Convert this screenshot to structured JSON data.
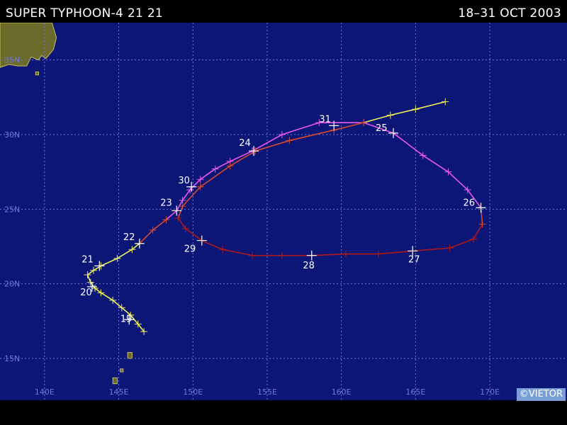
{
  "header": {
    "title": "SUPER TYPHOON-4  21 21",
    "dates": "18–31 OCT 2003"
  },
  "credit": "©VIETOR",
  "map": {
    "lon_range": [
      137,
      175.2
    ],
    "lat_range": [
      12.2,
      37.5
    ],
    "lon_ticks": [
      140,
      145,
      150,
      155,
      160,
      165,
      170
    ],
    "lat_ticks": [
      15,
      20,
      25,
      30,
      35
    ],
    "lon_labels": [
      "140E",
      "145E",
      "150E",
      "155E",
      "160E",
      "165E",
      "170E"
    ],
    "lat_labels": [
      "15N",
      "20N",
      "25N",
      "30N",
      "35N"
    ],
    "colors": {
      "ocean": "#0b1677",
      "grid": "#6f7bd8",
      "land": "#6b6a2a",
      "land_edge": "#c8c060",
      "tropical_storm": "#f0f05a",
      "typhoon": "#d84a2a",
      "super_typhoon": "#ea5aea",
      "dissipating": "#b11818"
    },
    "track": [
      {
        "lon": 146.7,
        "lat": 16.8,
        "cat": "tropical_storm"
      },
      {
        "lon": 146.3,
        "lat": 17.3,
        "cat": "tropical_storm"
      },
      {
        "lon": 145.8,
        "lat": 17.9,
        "cat": "tropical_storm"
      },
      {
        "lon": 145.2,
        "lat": 18.4,
        "cat": "tropical_storm"
      },
      {
        "lon": 144.6,
        "lat": 18.9,
        "cat": "tropical_storm"
      },
      {
        "lon": 143.8,
        "lat": 19.4,
        "cat": "tropical_storm"
      },
      {
        "lon": 143.4,
        "lat": 19.7,
        "cat": "tropical_storm"
      },
      {
        "lon": 143.1,
        "lat": 20.1,
        "cat": "tropical_storm"
      },
      {
        "lon": 142.9,
        "lat": 20.6,
        "cat": "tropical_storm"
      },
      {
        "lon": 143.3,
        "lat": 20.9,
        "cat": "tropical_storm"
      },
      {
        "lon": 143.8,
        "lat": 21.2,
        "cat": "tropical_storm"
      },
      {
        "lon": 144.9,
        "lat": 21.7,
        "cat": "tropical_storm"
      },
      {
        "lon": 145.9,
        "lat": 22.3,
        "cat": "tropical_storm"
      },
      {
        "lon": 146.4,
        "lat": 22.7,
        "cat": "tropical_storm"
      },
      {
        "lon": 147.3,
        "lat": 23.6,
        "cat": "typhoon"
      },
      {
        "lon": 148.2,
        "lat": 24.3,
        "cat": "typhoon"
      },
      {
        "lon": 148.9,
        "lat": 24.9,
        "cat": "super_typhoon"
      },
      {
        "lon": 149.3,
        "lat": 25.6,
        "cat": "super_typhoon"
      },
      {
        "lon": 149.8,
        "lat": 26.3,
        "cat": "super_typhoon"
      },
      {
        "lon": 150.5,
        "lat": 27.0,
        "cat": "super_typhoon"
      },
      {
        "lon": 151.5,
        "lat": 27.7,
        "cat": "super_typhoon"
      },
      {
        "lon": 152.5,
        "lat": 28.2,
        "cat": "super_typhoon"
      },
      {
        "lon": 154.0,
        "lat": 28.9,
        "cat": "super_typhoon"
      },
      {
        "lon": 156.0,
        "lat": 30.0,
        "cat": "super_typhoon"
      },
      {
        "lon": 158.5,
        "lat": 30.8,
        "cat": "super_typhoon"
      },
      {
        "lon": 161.5,
        "lat": 30.8,
        "cat": "super_typhoon"
      },
      {
        "lon": 163.5,
        "lat": 30.1,
        "cat": "super_typhoon"
      },
      {
        "lon": 165.5,
        "lat": 28.6,
        "cat": "super_typhoon"
      },
      {
        "lon": 167.2,
        "lat": 27.5,
        "cat": "super_typhoon"
      },
      {
        "lon": 168.5,
        "lat": 26.3,
        "cat": "super_typhoon"
      },
      {
        "lon": 169.4,
        "lat": 25.1,
        "cat": "super_typhoon"
      },
      {
        "lon": 169.5,
        "lat": 24.0,
        "cat": "typhoon"
      },
      {
        "lon": 168.9,
        "lat": 23.0,
        "cat": "dissipating"
      },
      {
        "lon": 167.3,
        "lat": 22.4,
        "cat": "dissipating"
      },
      {
        "lon": 164.8,
        "lat": 22.2,
        "cat": "dissipating"
      },
      {
        "lon": 162.5,
        "lat": 22.0,
        "cat": "dissipating"
      },
      {
        "lon": 160.3,
        "lat": 22.0,
        "cat": "dissipating"
      },
      {
        "lon": 158.0,
        "lat": 21.9,
        "cat": "dissipating"
      },
      {
        "lon": 156.0,
        "lat": 21.9,
        "cat": "dissipating"
      },
      {
        "lon": 154.0,
        "lat": 21.9,
        "cat": "dissipating"
      },
      {
        "lon": 152.0,
        "lat": 22.3,
        "cat": "dissipating"
      },
      {
        "lon": 150.6,
        "lat": 22.9,
        "cat": "dissipating"
      },
      {
        "lon": 149.5,
        "lat": 23.7,
        "cat": "dissipating"
      },
      {
        "lon": 149.0,
        "lat": 24.4,
        "cat": "dissipating"
      },
      {
        "lon": 149.3,
        "lat": 25.2,
        "cat": "typhoon"
      },
      {
        "lon": 150.5,
        "lat": 26.5,
        "cat": "typhoon"
      },
      {
        "lon": 152.5,
        "lat": 27.9,
        "cat": "typhoon"
      },
      {
        "lon": 154.2,
        "lat": 28.9,
        "cat": "typhoon"
      },
      {
        "lon": 156.5,
        "lat": 29.6,
        "cat": "typhoon"
      },
      {
        "lon": 159.5,
        "lat": 30.3,
        "cat": "typhoon"
      },
      {
        "lon": 161.5,
        "lat": 30.8,
        "cat": "typhoon"
      },
      {
        "lon": 163.3,
        "lat": 31.3,
        "cat": "tropical_storm"
      },
      {
        "lon": 165.0,
        "lat": 31.7,
        "cat": "tropical_storm"
      },
      {
        "lon": 167.0,
        "lat": 32.2,
        "cat": "tropical_storm"
      }
    ],
    "day_labels": [
      {
        "text": "19",
        "lon": 145.7,
        "lat": 17.6,
        "dlon": -0.2,
        "dlat": 0
      },
      {
        "text": "20",
        "lon": 143.2,
        "lat": 19.8,
        "dlon": -0.4,
        "dlat": -0.4
      },
      {
        "text": "21",
        "lon": 143.7,
        "lat": 21.2,
        "dlon": -0.8,
        "dlat": 0.4
      },
      {
        "text": "22",
        "lon": 146.4,
        "lat": 22.7,
        "dlon": -0.7,
        "dlat": 0.4
      },
      {
        "text": "23",
        "lon": 148.9,
        "lat": 24.9,
        "dlon": -0.7,
        "dlat": 0.5
      },
      {
        "text": "30",
        "lon": 149.9,
        "lat": 26.5,
        "dlon": -0.5,
        "dlat": 0.4
      },
      {
        "text": "24",
        "lon": 154.1,
        "lat": 28.9,
        "dlon": -0.6,
        "dlat": 0.5
      },
      {
        "text": "31",
        "lon": 159.5,
        "lat": 30.6,
        "dlon": -0.6,
        "dlat": 0.4
      },
      {
        "text": "25",
        "lon": 163.5,
        "lat": 30.1,
        "dlon": -0.8,
        "dlat": 0.3
      },
      {
        "text": "26",
        "lon": 169.4,
        "lat": 25.1,
        "dlon": -0.8,
        "dlat": 0.3
      },
      {
        "text": "27",
        "lon": 164.8,
        "lat": 22.2,
        "dlon": 0.1,
        "dlat": -0.6
      },
      {
        "text": "28",
        "lon": 158.0,
        "lat": 21.9,
        "dlon": -0.2,
        "dlat": -0.7
      },
      {
        "text": "29",
        "lon": 150.6,
        "lat": 22.9,
        "dlon": -0.8,
        "dlat": -0.6
      }
    ],
    "land": [
      {
        "name": "japan",
        "points": [
          [
            137,
            37.5
          ],
          [
            140.5,
            37.5
          ],
          [
            140.8,
            36.5
          ],
          [
            140.6,
            35.7
          ],
          [
            140.1,
            35.1
          ],
          [
            139.8,
            35.3
          ],
          [
            139.6,
            35.0
          ],
          [
            139.1,
            35.2
          ],
          [
            138.8,
            34.6
          ],
          [
            138.2,
            34.6
          ],
          [
            137.6,
            34.7
          ],
          [
            137,
            34.5
          ]
        ]
      },
      {
        "name": "izu-islands",
        "points": [
          [
            139.4,
            34.2
          ],
          [
            139.6,
            34.2
          ],
          [
            139.6,
            34.0
          ],
          [
            139.4,
            34.0
          ]
        ]
      },
      {
        "name": "guam",
        "points": [
          [
            144.6,
            13.7
          ],
          [
            144.9,
            13.7
          ],
          [
            144.9,
            13.3
          ],
          [
            144.6,
            13.3
          ]
        ]
      },
      {
        "name": "rota",
        "points": [
          [
            145.1,
            14.3
          ],
          [
            145.3,
            14.3
          ],
          [
            145.3,
            14.1
          ],
          [
            145.1,
            14.1
          ]
        ]
      },
      {
        "name": "saipan",
        "points": [
          [
            145.6,
            15.4
          ],
          [
            145.9,
            15.4
          ],
          [
            145.9,
            15.0
          ],
          [
            145.6,
            15.0
          ]
        ]
      }
    ]
  }
}
